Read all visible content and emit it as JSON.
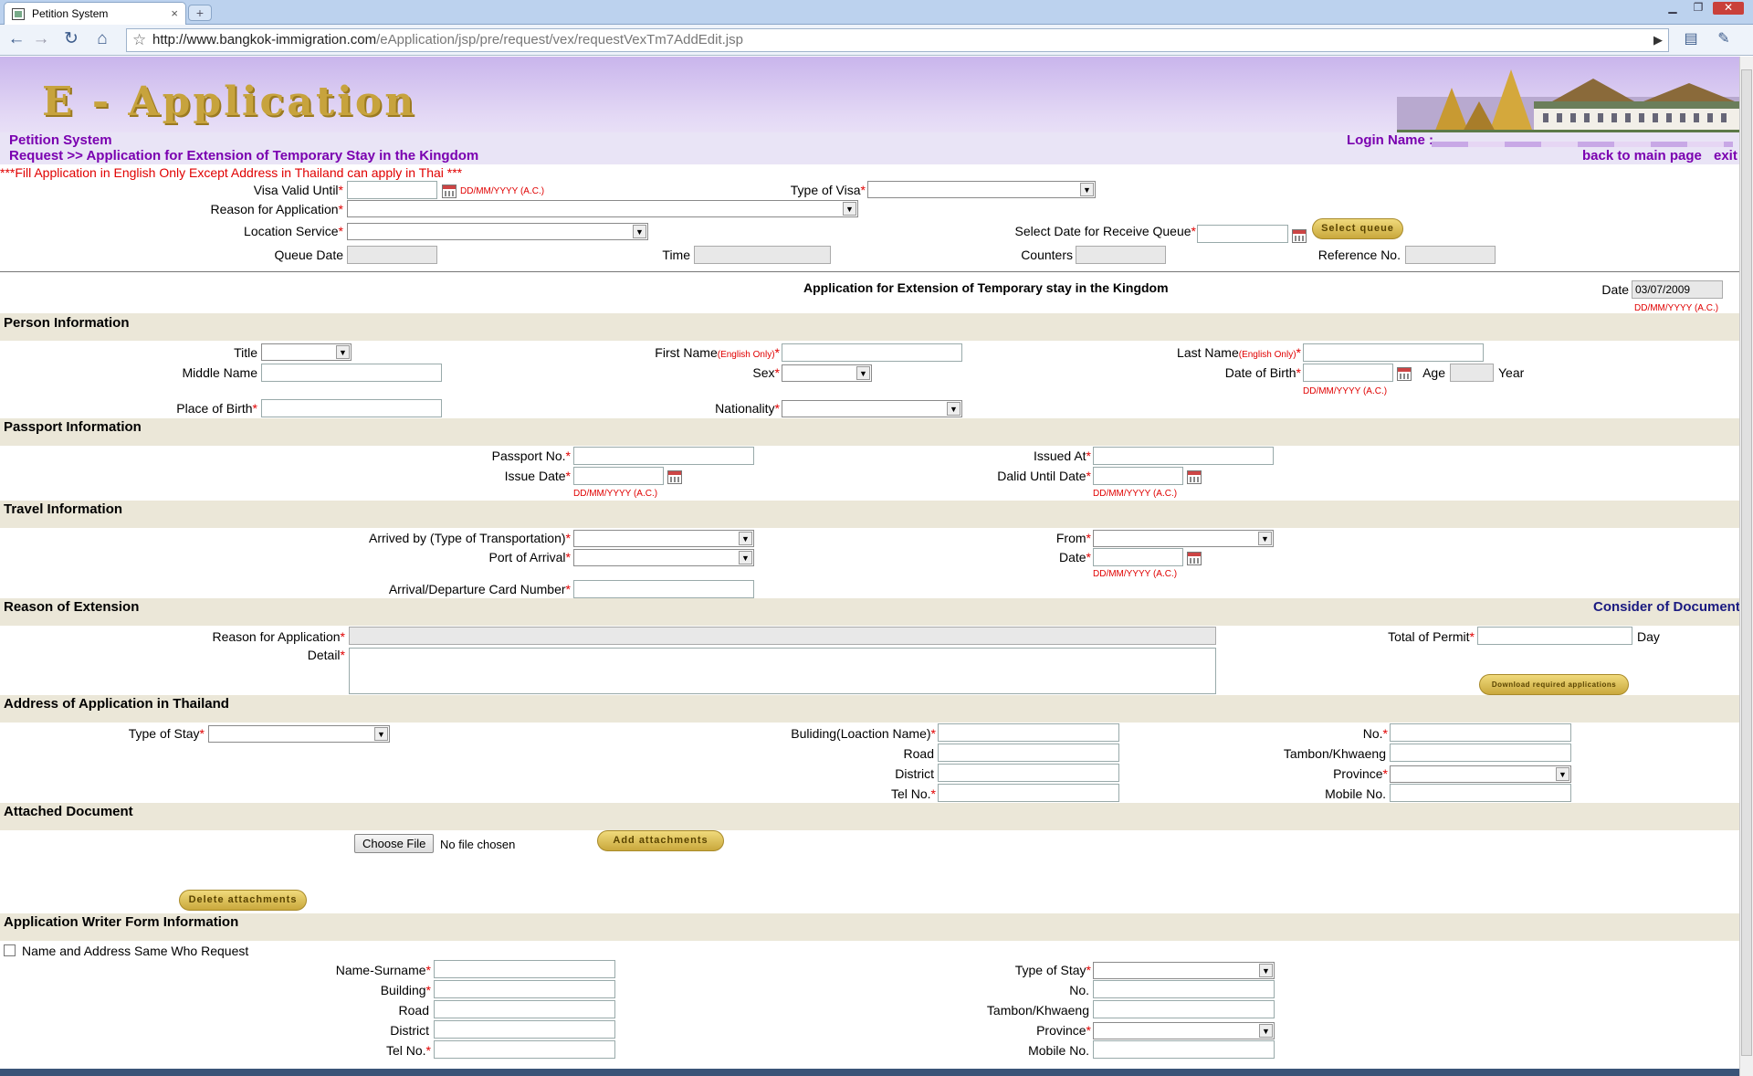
{
  "browser": {
    "tab_title": "Petition System",
    "tab_close": "×",
    "new_tab": "+",
    "url_prefix": "http://www.bangkok-immigration.com",
    "url_path": "/eApplication/jsp/pre/request/vex/requestVexTm7AddEdit.jsp"
  },
  "header": {
    "title": "E - Application",
    "system": "Petition System",
    "breadcrumb": "Request >> Application for Extension of Temporary Stay in the Kingdom",
    "login_label": "Login Name :",
    "back_link": "back to main page",
    "exit_link": "exit"
  },
  "notice": "***Fill Application in English Only Except Address in Thailand can apply in Thai ***",
  "queue": {
    "visa_valid_until": "Visa Valid Until",
    "date_hint": "DD/MM/YYYY (A.C.)",
    "type_of_visa": "Type of Visa",
    "reason_for_application": "Reason for Application",
    "location_service": "Location Service",
    "select_date": "Select Date for Receive Queue",
    "select_queue_btn": "Select queue",
    "queue_date": "Queue Date",
    "time": "Time",
    "counters": "Counters",
    "reference_no": "Reference No."
  },
  "form": {
    "title": "Application for Extension of Temporary stay in the Kingdom",
    "date_label": "Date",
    "date_value": "03/07/2009",
    "date_hint": "DD/MM/YYYY (A.C.)"
  },
  "person": {
    "section": "Person Information",
    "title": "Title",
    "first_name": "First Name",
    "english_only": "(English Only)",
    "last_name": "Last Name",
    "middle_name": "Middle Name",
    "sex": "Sex",
    "dob": "Date of Birth",
    "age": "Age",
    "year": "Year",
    "place_of_birth": "Place of Birth",
    "nationality": "Nationality"
  },
  "passport": {
    "section": "Passport Information",
    "passport_no": "Passport No.",
    "issued_at": "Issued At",
    "issue_date": "Issue Date",
    "valid_until": "Dalid Until Date"
  },
  "travel": {
    "section": "Travel Information",
    "arrived_by": "Arrived by (Type of Transportation)",
    "from": "From",
    "port": "Port of Arrival",
    "date": "Date",
    "card_no": "Arrival/Departure Card Number"
  },
  "extension": {
    "section": "Reason of Extension",
    "consider": "Consider of Document",
    "reason": "Reason for Application",
    "total_permit": "Total of Permit",
    "day": "Day",
    "detail": "Detail",
    "download_btn": "Download required applications"
  },
  "address": {
    "section": "Address of Application in Thailand",
    "type_of_stay": "Type of Stay",
    "building": "Buliding(Loaction Name)",
    "no": "No.",
    "road": "Road",
    "tambon": "Tambon/Khwaeng",
    "district": "District",
    "province": "Province",
    "tel": "Tel No.",
    "mobile": "Mobile No."
  },
  "attach": {
    "section": "Attached Document",
    "choose_file": "Choose File",
    "no_file": "No file chosen",
    "add_btn": "Add attachments",
    "delete_btn": "Delete attachments"
  },
  "writer": {
    "section": "Application Writer Form Information",
    "same_as": "Name and Address Same Who Request",
    "name": "Name-Surname",
    "building": "Building",
    "road": "Road",
    "district": "District",
    "tel": "Tel No.",
    "type_of_stay": "Type of Stay",
    "no": "No.",
    "tambon": "Tambon/Khwaeng",
    "province": "Province",
    "mobile": "Mobile No."
  },
  "required_mark": "*",
  "colors": {
    "banner_purple": "#c9b5ec",
    "section_bg": "#ebe7d8",
    "link_purple": "#7a00b0",
    "required_red": "#e00000",
    "gold_button": "#d9bb55"
  }
}
